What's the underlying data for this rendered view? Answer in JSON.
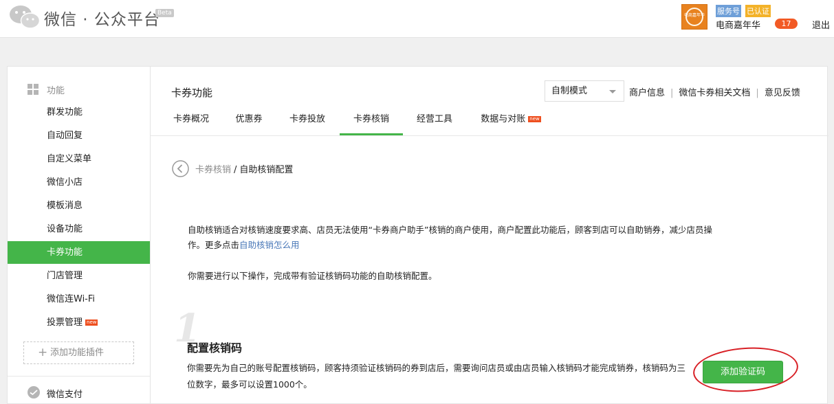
{
  "header": {
    "brand": "微信 · 公众平台",
    "beta": "Beta",
    "avatar_text": "电商嘉年华",
    "badge_service": "服务号",
    "badge_verified": "已认证",
    "account_name": "电商嘉年华",
    "notification_count": "17",
    "logout_label": "退出"
  },
  "sidebar": {
    "category_label": "功能",
    "items": [
      {
        "label": "群发功能"
      },
      {
        "label": "自动回复"
      },
      {
        "label": "自定义菜单"
      },
      {
        "label": "微信小店"
      },
      {
        "label": "模板消息"
      },
      {
        "label": "设备功能"
      },
      {
        "label": "卡券功能"
      },
      {
        "label": "门店管理"
      },
      {
        "label": "微信连Wi-Fi"
      },
      {
        "label": "投票管理"
      }
    ],
    "new_tag": "new",
    "add_plugin_label": "添加功能插件",
    "pay_label": "微信支付"
  },
  "main": {
    "title": "卡券功能",
    "mode_select": "自制模式",
    "links": [
      "商户信息",
      "微信卡券相关文档",
      "意见反馈"
    ],
    "tabs": [
      "卡券概况",
      "优惠券",
      "卡券投放",
      "卡券核销",
      "经营工具",
      "数据与对账"
    ],
    "new_tag": "new",
    "breadcrumb_parent": "卡券核销",
    "breadcrumb_sep": "/",
    "breadcrumb_current": "自助核销配置",
    "desc_text": "自助核销适合对核销速度要求高、店员无法使用“卡券商户助手”核销的商户使用，商户配置此功能后，顾客到店可以自助销券，减少店员操作。更多点击",
    "desc_link": "自助核销怎么用",
    "desc2": "你需要进行以下操作，完成带有验证核销码功能的自助核销配置。",
    "step_number": "1",
    "step_title": "配置核销码",
    "step_desc": "你需要先为自己的账号配置核销码，顾客持须验证核销码的券到店后，需要询问店员或由店员输入核销码才能完成销券，核销码为三位数字，最多可以设置1000个。",
    "add_button": "添加验证码"
  },
  "colors": {
    "accent": "#44b549",
    "annotation": "#d81f25",
    "badge_service": "#6e9fd8",
    "badge_verified": "#f3b229",
    "notify": "#f25a25"
  }
}
